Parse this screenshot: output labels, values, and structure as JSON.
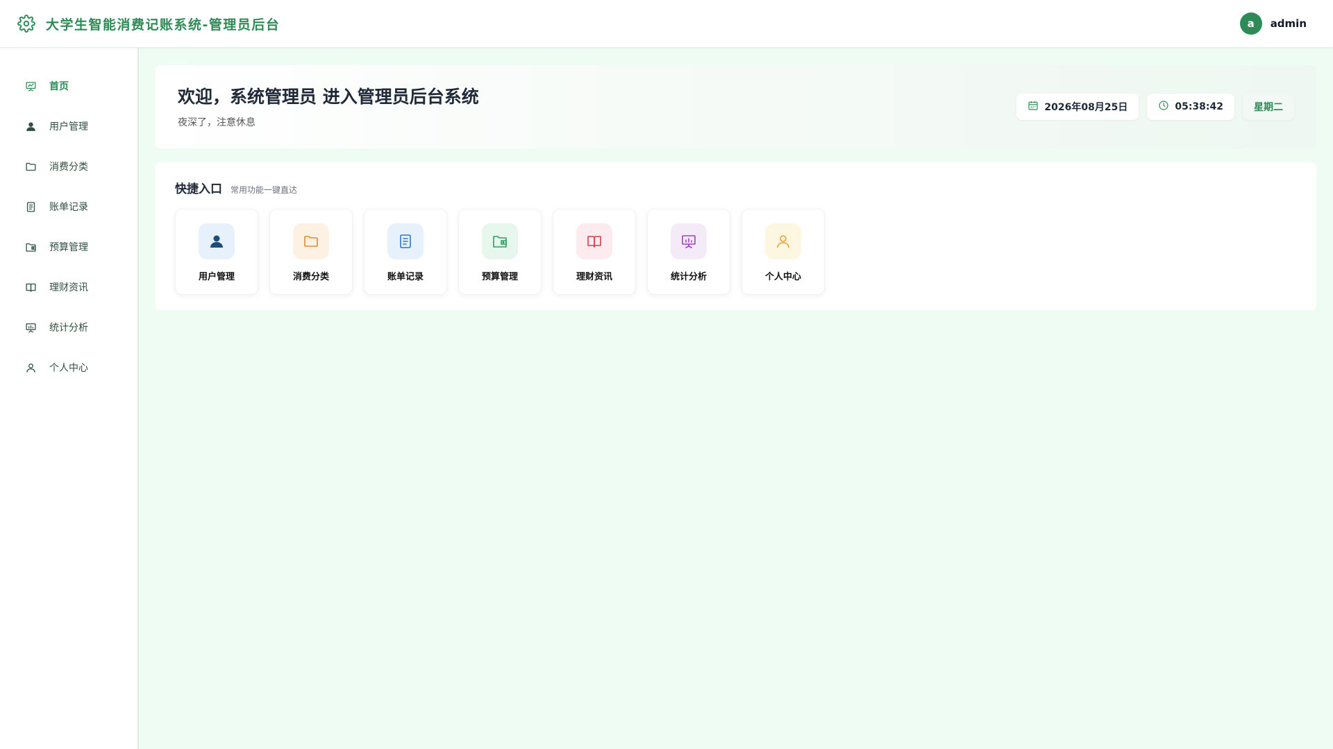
{
  "header": {
    "title": "大学生智能消费记账系统-管理员后台",
    "user": {
      "avatar_letter": "a",
      "name": "admin"
    },
    "brand_icon": "gear-icon"
  },
  "sidebar": {
    "items": [
      {
        "label": "首页",
        "icon": "presentation-chart-icon",
        "active": true
      },
      {
        "label": "用户管理",
        "icon": "user-icon"
      },
      {
        "label": "消费分类",
        "icon": "folder-icon"
      },
      {
        "label": "账单记录",
        "icon": "document-icon"
      },
      {
        "label": "预算管理",
        "icon": "wallet-icon"
      },
      {
        "label": "理财资讯",
        "icon": "book-icon"
      },
      {
        "label": "统计分析",
        "icon": "presentation-chart-icon"
      },
      {
        "label": "个人中心",
        "icon": "person-outline-icon"
      }
    ]
  },
  "welcome": {
    "title": "欢迎，系统管理员 进入管理员后台系统",
    "subtitle": "夜深了，注意休息",
    "date": "2026年08月25日",
    "time": "05:38:42",
    "weekday": "星期二"
  },
  "quick": {
    "title": "快捷入口",
    "subtitle": "常用功能一键直达",
    "items": [
      {
        "label": "用户管理",
        "icon": "user-icon",
        "bg": "#e6f1fb",
        "color": "#1e4d7b"
      },
      {
        "label": "消费分类",
        "icon": "folder-icon",
        "bg": "#fdf1e3",
        "color": "#e08a2c"
      },
      {
        "label": "账单记录",
        "icon": "document-icon",
        "bg": "#e6f1fb",
        "color": "#2f78c4"
      },
      {
        "label": "预算管理",
        "icon": "wallet-icon",
        "bg": "#e8f7ee",
        "color": "#2e9e5b"
      },
      {
        "label": "理财资讯",
        "icon": "book-icon",
        "bg": "#fdecef",
        "color": "#d63a4a"
      },
      {
        "label": "统计分析",
        "icon": "presentation-chart-icon",
        "bg": "#f4ebf8",
        "color": "#9c3fbf"
      },
      {
        "label": "个人中心",
        "icon": "person-outline-icon",
        "bg": "#fdf6e0",
        "color": "#e3a22b"
      }
    ]
  },
  "colors": {
    "accent": "#2e8b57",
    "background": "#effcf3"
  }
}
